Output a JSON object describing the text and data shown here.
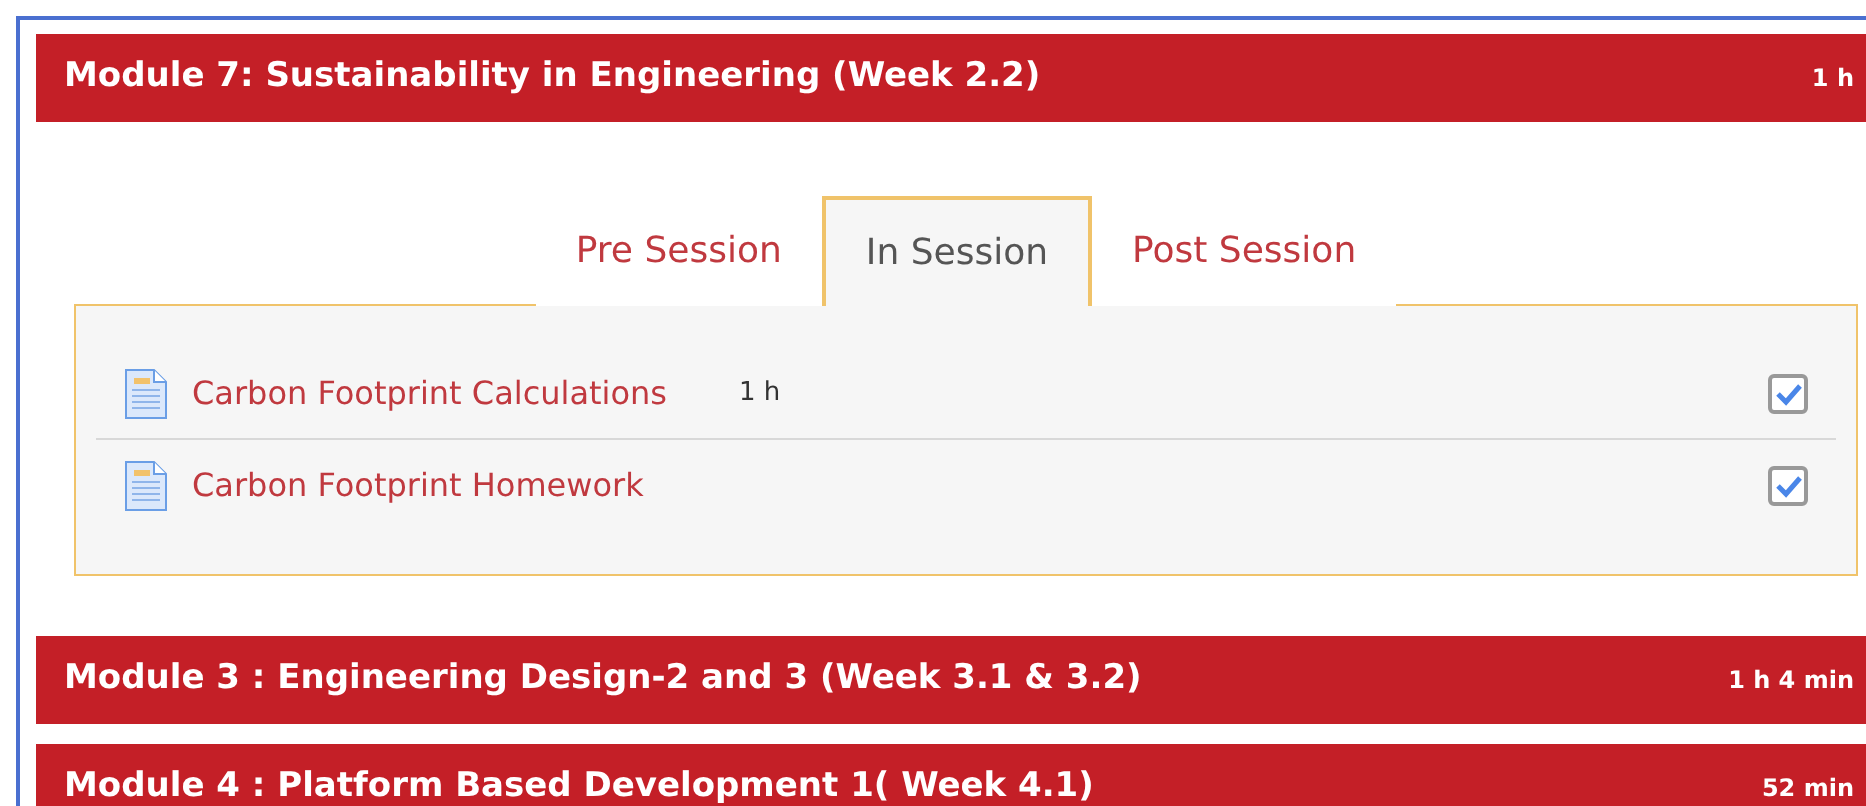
{
  "modules": [
    {
      "title": "Module 7: Sustainability in Engineering (Week 2.2)",
      "duration": "1 h",
      "tabs": [
        {
          "label": "Pre Session",
          "selected": false
        },
        {
          "label": "In Session",
          "selected": true
        },
        {
          "label": "Post Session",
          "selected": false
        }
      ],
      "items": [
        {
          "title": "Carbon Footprint Calculations",
          "duration": "1 h",
          "checked": true
        },
        {
          "title": "Carbon Footprint Homework",
          "checked": true
        }
      ]
    },
    {
      "title": "Module 3 : Engineering Design-2 and 3 (Week 3.1 & 3.2)",
      "duration": "1 h 4 min"
    },
    {
      "title": "Module 4 : Platform Based Development 1( Week 4.1)",
      "duration": "52 min"
    }
  ]
}
